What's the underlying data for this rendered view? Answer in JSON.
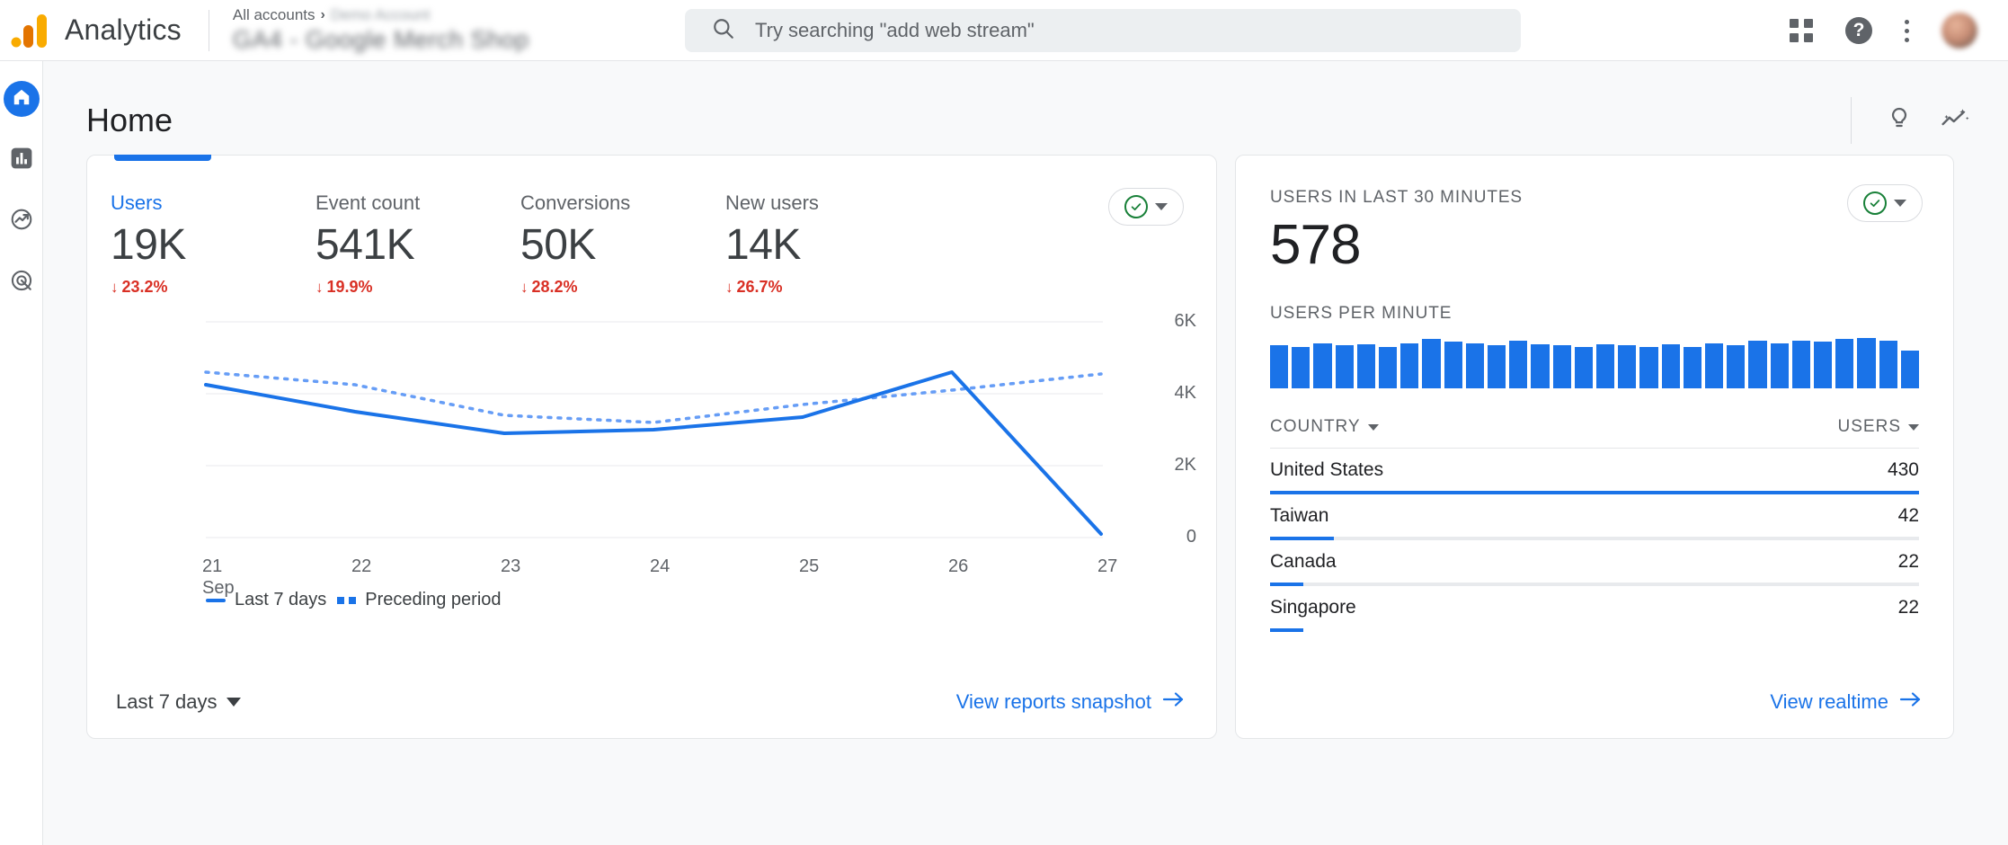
{
  "topbar": {
    "brand": "Analytics",
    "breadcrumb_root": "All accounts",
    "breadcrumb_sep": "›",
    "breadcrumb_account": "Demo Account",
    "property": "GA4 - Google Merch Shop",
    "search_placeholder": "Try searching \"add web stream\"",
    "search_value": "",
    "icons": {
      "search": "search-icon",
      "apps": "apps-grid-icon",
      "help": "?",
      "more": "more-vert-icon",
      "avatar": "user-avatar"
    }
  },
  "sidebar": {
    "items": [
      {
        "name": "home",
        "label": "Home",
        "active": true
      },
      {
        "name": "reports",
        "label": "Reports",
        "active": false
      },
      {
        "name": "explore",
        "label": "Explore",
        "active": false
      },
      {
        "name": "advertising",
        "label": "Advertising",
        "active": false
      }
    ]
  },
  "page": {
    "title": "Home",
    "header_icons": [
      "insights-lightbulb-icon",
      "intelligence-sparkline-icon"
    ]
  },
  "overview_card": {
    "metrics": [
      {
        "label": "Users",
        "value": "19K",
        "delta": "23.2%",
        "direction": "down",
        "selected": true
      },
      {
        "label": "Event count",
        "value": "541K",
        "delta": "19.9%",
        "direction": "down",
        "selected": false
      },
      {
        "label": "Conversions",
        "value": "50K",
        "delta": "28.2%",
        "direction": "down",
        "selected": false
      },
      {
        "label": "New users",
        "value": "14K",
        "delta": "26.7%",
        "direction": "down",
        "selected": false
      }
    ],
    "delta_color": "#d93025",
    "accent_color": "#1a73e8",
    "status_badge": "data-collection-ok",
    "legend": [
      {
        "label": "Last 7 days",
        "style": "solid"
      },
      {
        "label": "Preceding period",
        "style": "dotted"
      }
    ],
    "date_range": "Last 7 days",
    "footer_link": "View reports snapshot"
  },
  "chart_data": {
    "type": "line",
    "title": "Users",
    "xlabel": "",
    "ylabel": "",
    "x": [
      "21",
      "22",
      "23",
      "24",
      "25",
      "26",
      "27"
    ],
    "x_month": "Sep",
    "yticks": [
      "0",
      "2K",
      "4K",
      "6K"
    ],
    "ylim": [
      0,
      6000
    ],
    "grid": true,
    "legend_position": "bottom-left",
    "series": [
      {
        "name": "Last 7 days",
        "style": "solid",
        "color": "#1a73e8",
        "values": [
          4250,
          3500,
          2900,
          3000,
          3350,
          4450,
          100
        ]
      },
      {
        "name": "Preceding period",
        "style": "dotted",
        "color": "#669df6",
        "values": [
          4600,
          4250,
          3400,
          3200,
          3700,
          4100,
          4450
        ]
      }
    ]
  },
  "realtime_card": {
    "headline_label": "USERS IN LAST 30 MINUTES",
    "headline_value": "578",
    "per_minute_label": "USERS PER MINUTE",
    "status_badge": "data-collection-ok",
    "per_minute_values": [
      34,
      33,
      36,
      34,
      35,
      33,
      36,
      39,
      37,
      36,
      34,
      38,
      35,
      34,
      33,
      35,
      34,
      33,
      35,
      33,
      36,
      34,
      38,
      36,
      38,
      37,
      39,
      40,
      38,
      30
    ],
    "table": {
      "columns": [
        "COUNTRY",
        "USERS"
      ],
      "rows": [
        {
          "country": "United States",
          "users": "430",
          "bar_pct": 100
        },
        {
          "country": "Taiwan",
          "users": "42",
          "bar_pct": 9.8
        },
        {
          "country": "Canada",
          "users": "22",
          "bar_pct": 5.1
        },
        {
          "country": "Singapore",
          "users": "22",
          "bar_pct": 5.1
        }
      ]
    },
    "footer_link": "View realtime"
  }
}
